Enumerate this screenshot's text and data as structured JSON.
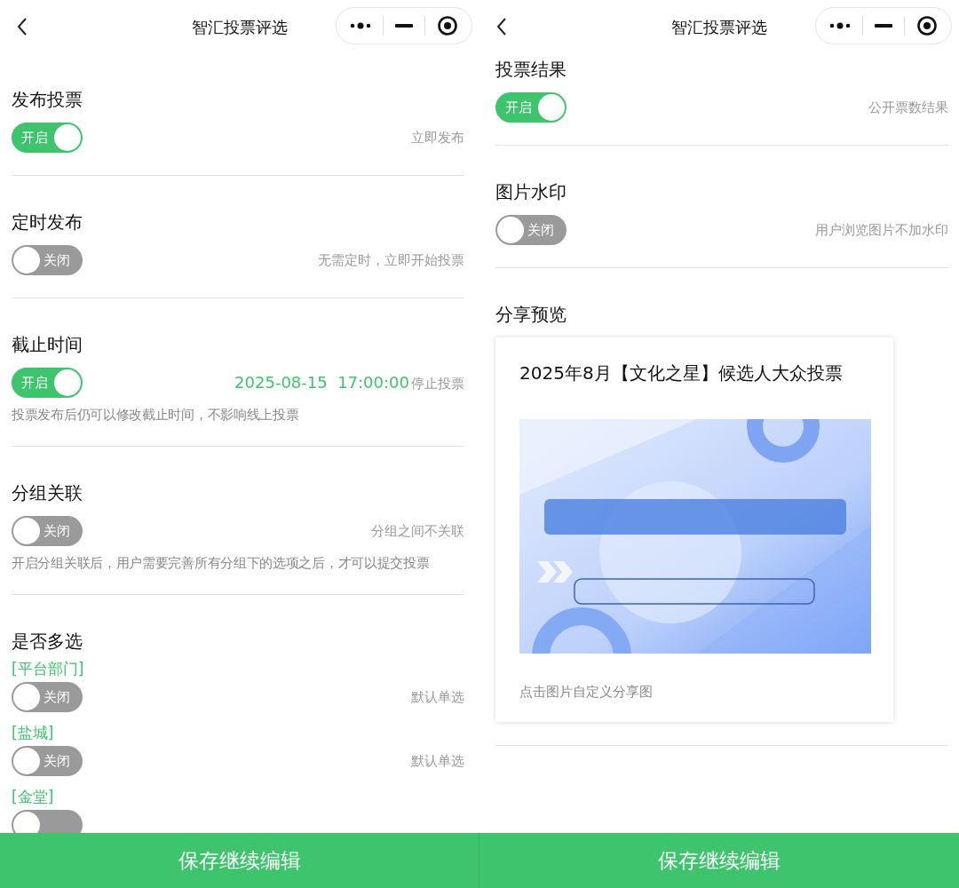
{
  "panels": [
    {
      "header": {
        "title": "智汇投票评选"
      },
      "sections": [
        {
          "kind": "toggle",
          "title": "发布投票",
          "toggle": {
            "label": "开启",
            "on": true
          },
          "note": "立即发布"
        },
        {
          "kind": "toggle",
          "title": "定时发布",
          "toggle": {
            "label": "关闭",
            "on": false
          },
          "note": "无需定时，立即开始投票"
        },
        {
          "kind": "toggle",
          "title": "截止时间",
          "toggle": {
            "label": "开启",
            "on": true
          },
          "value": "2025-08-15  17:00:00",
          "note": "停止投票",
          "hint": "投票发布后仍可以修改截止时间，不影响线上投票"
        },
        {
          "kind": "toggle",
          "title": "分组关联",
          "toggle": {
            "label": "关闭",
            "on": false
          },
          "note": "分组之间不关联",
          "hint": "开启分组关联后，用户需要完善所有分组下的选项之后，才可以提交投票"
        },
        {
          "kind": "groups",
          "title": "是否多选",
          "groups": [
            {
              "label": "[平台部门]",
              "toggle": {
                "label": "关闭",
                "on": false
              },
              "note": "默认单选"
            },
            {
              "label": "[盐城]",
              "toggle": {
                "label": "关闭",
                "on": false
              },
              "note": "默认单选"
            },
            {
              "label": "[金堂]",
              "toggle": {
                "on": false
              }
            }
          ]
        }
      ],
      "footer_button": "保存继续编辑"
    },
    {
      "header": {
        "title": "智汇投票评选"
      },
      "sections": [
        {
          "kind": "toggle",
          "title": "投票结果",
          "toggle": {
            "label": "开启",
            "on": true
          },
          "note": "公开票数结果"
        },
        {
          "kind": "toggle",
          "title": "图片水印",
          "toggle": {
            "label": "关闭",
            "on": false
          },
          "note": "用户浏览图片不加水印"
        },
        {
          "kind": "share",
          "title": "分享预览",
          "card": {
            "title": "2025年8月【文化之星】候选人大众投票",
            "caption": "点击图片自定义分享图"
          }
        }
      ],
      "footer_button": "保存继续编辑"
    }
  ]
}
